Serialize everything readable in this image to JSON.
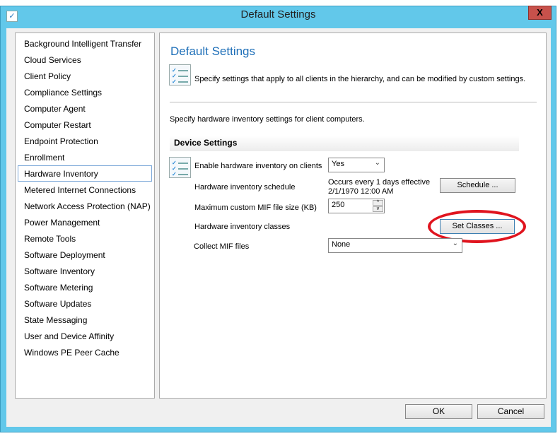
{
  "window": {
    "title": "Default Settings",
    "close_label": "X"
  },
  "nav": {
    "items": [
      "Background Intelligent Transfer",
      "Cloud Services",
      "Client Policy",
      "Compliance Settings",
      "Computer Agent",
      "Computer Restart",
      "Endpoint Protection",
      "Enrollment",
      "Hardware Inventory",
      "Metered Internet Connections",
      "Network Access Protection (NAP)",
      "Power Management",
      "Remote Tools",
      "Software Deployment",
      "Software Inventory",
      "Software Metering",
      "Software Updates",
      "State Messaging",
      "User and Device Affinity",
      "Windows PE Peer Cache"
    ],
    "selected": "Hardware Inventory"
  },
  "main": {
    "title": "Default Settings",
    "description": "Specify settings that apply to all clients in the hierarchy, and can be modified by custom settings.",
    "subtitle": "Specify hardware inventory settings for client computers.",
    "section": "Device Settings",
    "enable_label": "Enable hardware inventory on clients",
    "enable_value": "Yes",
    "schedule_label": "Hardware inventory schedule",
    "schedule_line1": "Occurs every 1 days effective",
    "schedule_line2": "2/1/1970 12:00 AM",
    "schedule_button": "Schedule ...",
    "mif_size_label": "Maximum custom MIF file size (KB)",
    "mif_size_value": "250",
    "classes_label": "Hardware inventory classes",
    "classes_button": "Set Classes ...",
    "collect_label": "Collect MIF files",
    "collect_value": "None"
  },
  "footer": {
    "ok": "OK",
    "cancel": "Cancel"
  },
  "annotation_color": "#e0141e"
}
